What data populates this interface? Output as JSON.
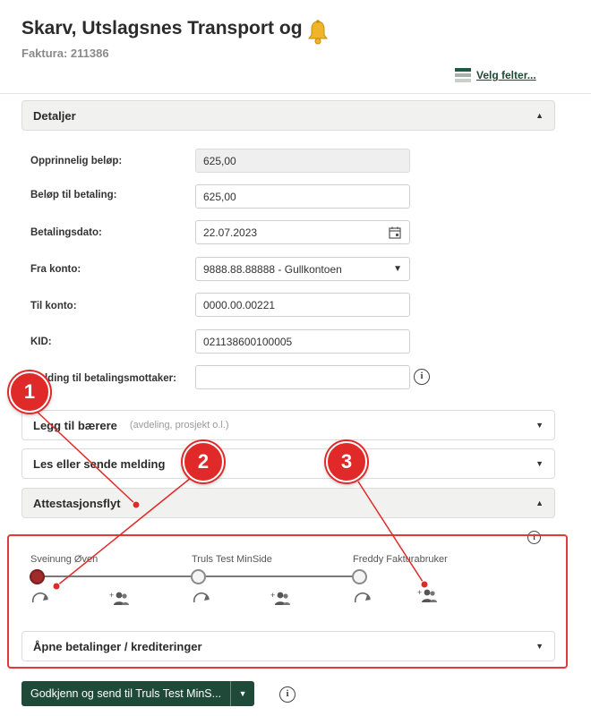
{
  "header": {
    "title": "Skarv, Utslagsnes Transport og",
    "subtitle": "Faktura: 211386",
    "velg_felter": "Velg felter..."
  },
  "detaljer": {
    "title": "Detaljer",
    "fields": {
      "opprinnelig_label": "Opprinnelig beløp:",
      "opprinnelig_value": "625,00",
      "belop_label": "Beløp til betaling:",
      "belop_value": "625,00",
      "dato_label": "Betalingsdato:",
      "dato_value": "22.07.2023",
      "fra_label": "Fra konto:",
      "fra_value": "9888.88.88888 - Gullkontoen",
      "til_label": "Til konto:",
      "til_value": "0000.00.00221",
      "kid_label": "KID:",
      "kid_value": "021138600100005",
      "melding_label": "Melding til betalingsmottaker:",
      "melding_value": ""
    }
  },
  "panels": {
    "baerere_title": "Legg til bærere",
    "baerere_hint": "(avdeling, prosjekt o.l.)",
    "melding_title": "Les eller sende melding",
    "attestasjon_title": "Attestasjonsflyt",
    "apne_title": "Åpne betalinger / krediteringer"
  },
  "flow": {
    "steps": [
      "Sveinung Øven",
      "Truls Test MinSide",
      "Freddy Fakturabruker"
    ]
  },
  "callouts": [
    "1",
    "2",
    "3"
  ],
  "action": {
    "primary_label": "Godkjenn og send til Truls Test MinS..."
  },
  "colors": {
    "accent": "#1f4a3a",
    "callout": "#e02a2a",
    "active_step": "#a02b2b"
  }
}
